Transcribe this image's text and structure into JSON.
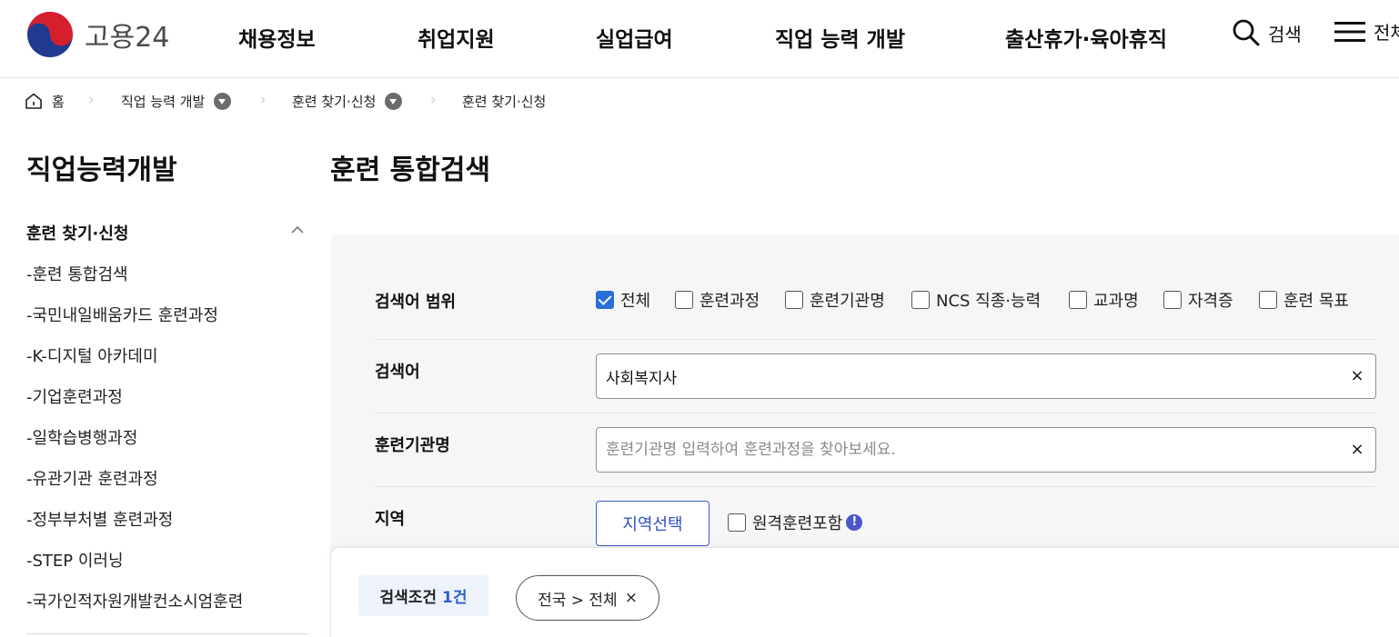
{
  "header": {
    "logo_text": "고용24",
    "nav": [
      "채용정보",
      "취업지원",
      "실업급여",
      "직업 능력 개발",
      "출산휴가·육아휴직"
    ],
    "search_label": "검색",
    "menu_label": "전체"
  },
  "breadcrumb": {
    "home": "홈",
    "level1": "직업 능력 개발",
    "level2": "훈련 찾기·신청",
    "current": "훈련 찾기·신청"
  },
  "sidebar": {
    "title": "직업능력개발",
    "group": "훈련 찾기·신청",
    "items": [
      "훈련 통합검색",
      "국민내일배움카드 훈련과정",
      "K-디지털 아카데미",
      "기업훈련과정",
      "일학습병행과정",
      "유관기관 훈련과정",
      "정부부처별 훈련과정",
      "STEP 이러닝",
      "국가인적자원개발컨소시엄훈련"
    ],
    "item_prefix": "-"
  },
  "main": {
    "title": "훈련 통합검색",
    "scope": {
      "label": "검색어 범위",
      "options": [
        {
          "label": "전체",
          "checked": true
        },
        {
          "label": "훈련과정",
          "checked": false
        },
        {
          "label": "훈련기관명",
          "checked": false
        },
        {
          "label": "NCS 직종·능력",
          "checked": false
        },
        {
          "label": "교과명",
          "checked": false
        },
        {
          "label": "자격증",
          "checked": false
        },
        {
          "label": "훈련 목표",
          "checked": false
        }
      ]
    },
    "keyword": {
      "label": "검색어",
      "value": "사회복지사"
    },
    "institution": {
      "label": "훈련기관명",
      "value": "",
      "placeholder": "훈련기관명 입력하여 훈련과정을 찾아보세요."
    },
    "region": {
      "label": "지역",
      "button": "지역선택",
      "remote_label": "원격훈련포함",
      "remote_checked": false
    },
    "clear_symbol": "×"
  },
  "result": {
    "condition_label": "검색조건",
    "condition_count": "1건",
    "chip_text": "전국 > 전체",
    "chip_remove": "×"
  },
  "colors": {
    "accent": "#2a6fd6",
    "region_button": "#2f4fc4",
    "panel_bg": "#f6f6f7",
    "condition_bg": "#eef3fb"
  }
}
